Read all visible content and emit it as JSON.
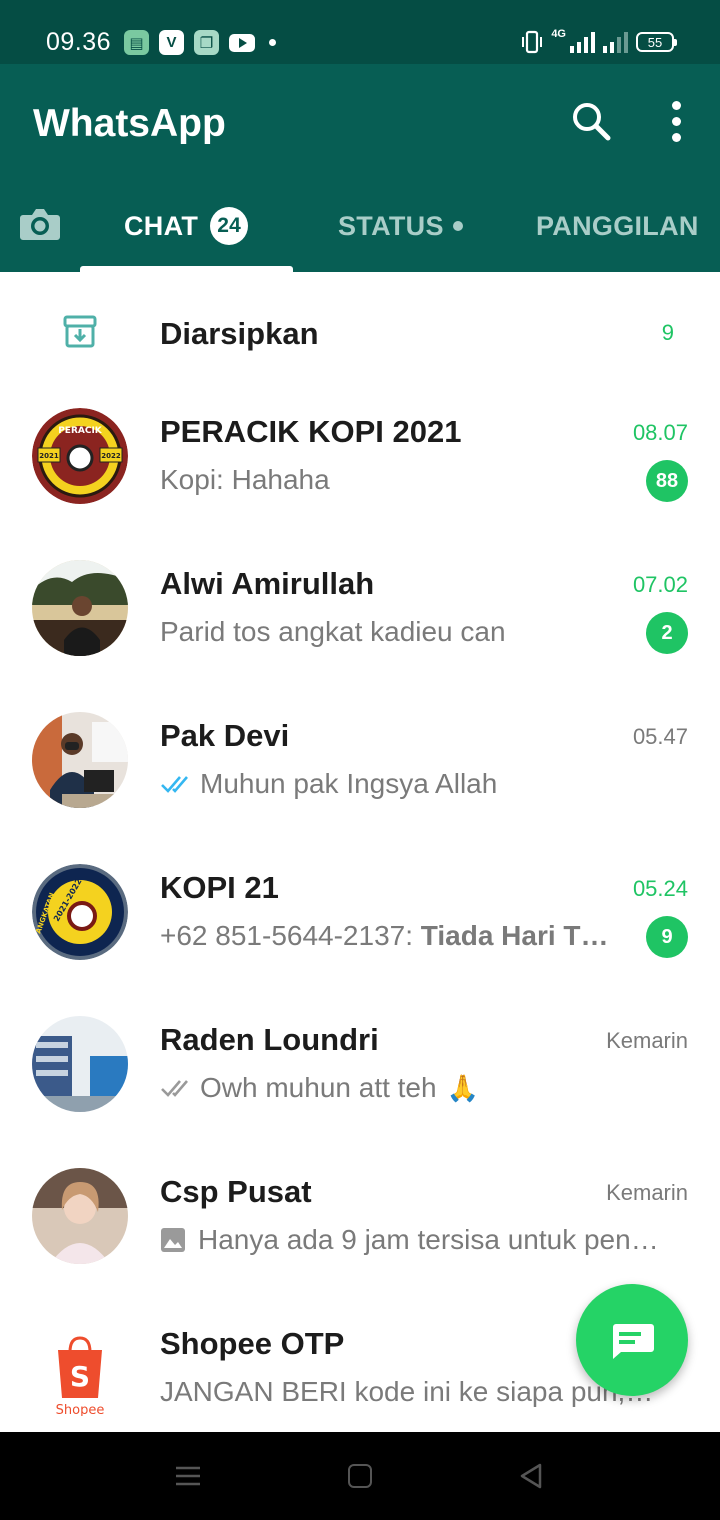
{
  "status_bar": {
    "time": "09.36",
    "network": "4G",
    "battery": "55"
  },
  "app_bar": {
    "title": "WhatsApp",
    "search_icon": "search-icon",
    "more_icon": "more-vert-icon"
  },
  "tabs": {
    "camera_icon": "camera-icon",
    "chat": {
      "label": "CHAT",
      "badge": "24"
    },
    "status": {
      "label": "STATUS"
    },
    "calls": {
      "label": "PANGGILAN"
    }
  },
  "archived": {
    "label": "Diarsipkan",
    "count": "9"
  },
  "chats": [
    {
      "name": "PERACIK KOPI 2021",
      "time": "08.07",
      "message": "Kopi: Hahaha",
      "unread": "88",
      "avatar_text": "PERACIK"
    },
    {
      "name": "Alwi Amirullah",
      "time": "07.02",
      "message": "Parid tos angkat kadieu can",
      "unread": "2"
    },
    {
      "name": "Pak Devi",
      "time": "05.47",
      "message": "Muhun pak Ingsya Allah",
      "read_status": "read"
    },
    {
      "name": "KOPI 21",
      "time": "05.24",
      "sender": "+62 851-5644-2137: ",
      "message": "Tiada Hari T…",
      "unread": "9",
      "avatar_text": "ANGKATAN"
    },
    {
      "name": "Raden Loundri",
      "time": "Kemarin",
      "message": "Owh muhun att teh",
      "emoji": "🙏",
      "read_status": "delivered"
    },
    {
      "name": "Csp Pusat",
      "time": "Kemarin",
      "message": "Hanya ada 9 jam tersisa untuk pen…",
      "media_icon": "image-icon"
    },
    {
      "name": "Shopee OTP",
      "time": "",
      "message": "JANGAN BERI kode ini ke siapa pun,…",
      "avatar_text": "Shopee"
    }
  ],
  "colors": {
    "status_bar": "#054d44",
    "app_bar": "#075e54",
    "accent": "#25d366",
    "unread": "#1fc464",
    "read_ticks": "#34b7f1"
  },
  "fab": {
    "icon": "new-chat-icon"
  },
  "nav_bar": {
    "icons": [
      "menu-icon",
      "home-icon",
      "back-icon"
    ]
  }
}
